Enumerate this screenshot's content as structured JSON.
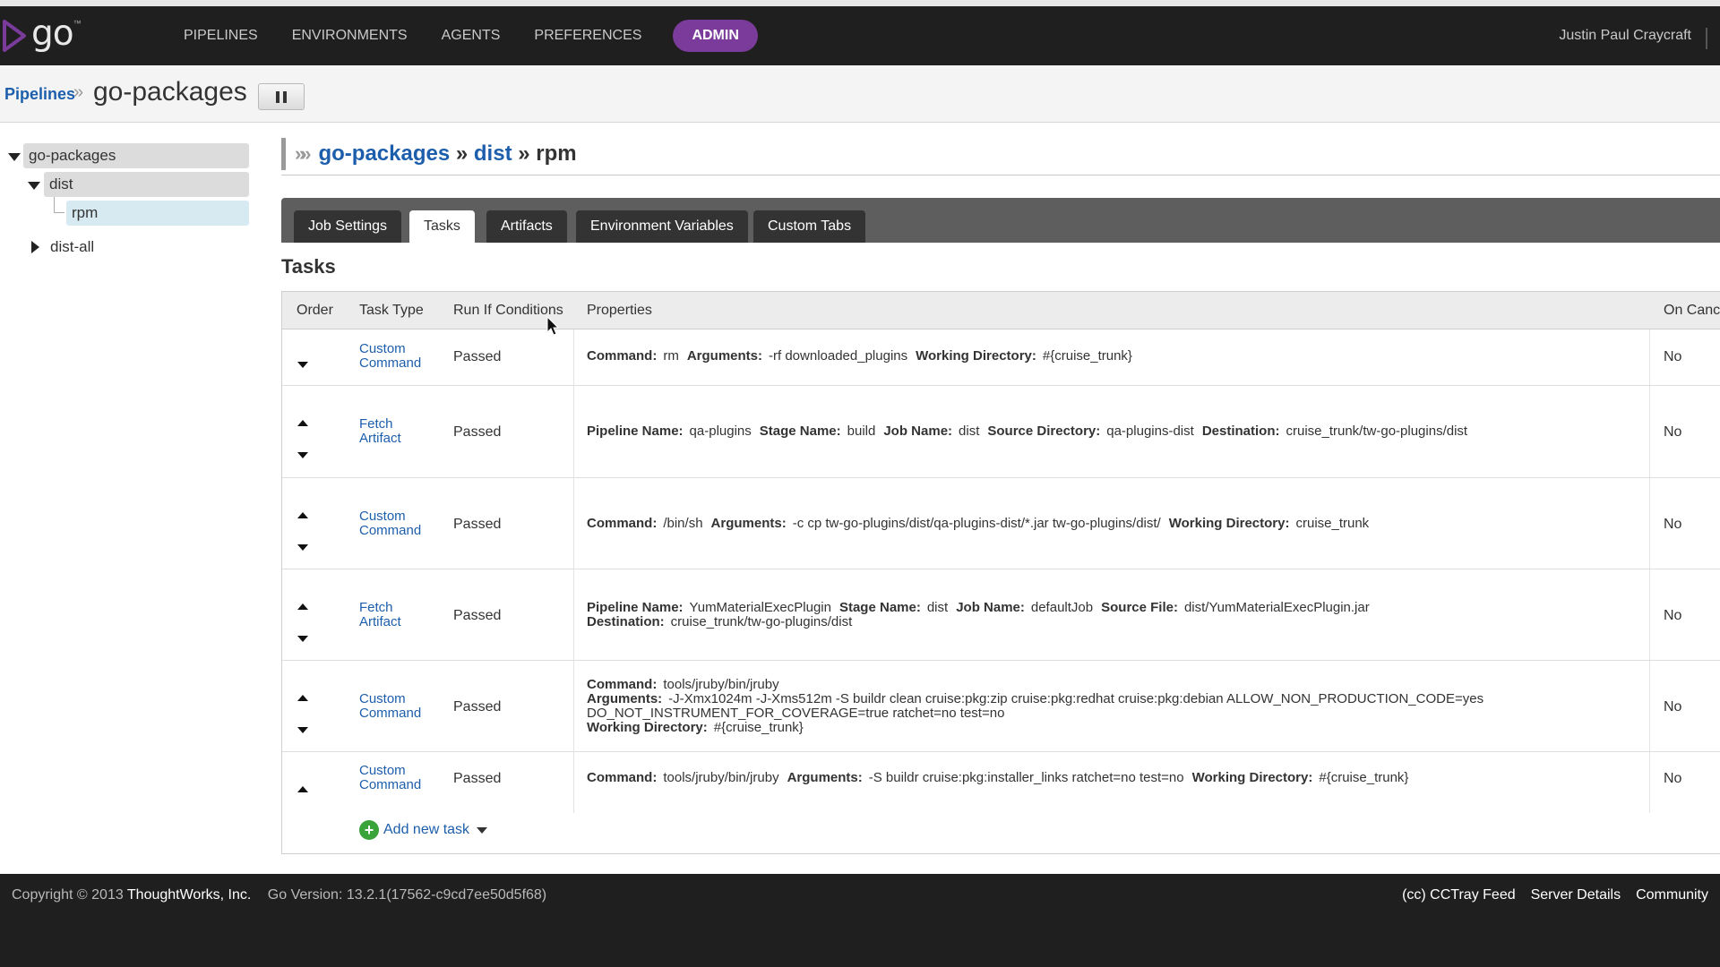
{
  "header": {
    "logo_text": "go",
    "nav": [
      "PIPELINES",
      "ENVIRONMENTS",
      "AGENTS",
      "PREFERENCES",
      "ADMIN"
    ],
    "active_nav": "ADMIN",
    "user": "Justin Paul Craycraft"
  },
  "subheader": {
    "breadcrumb_link": "Pipelines",
    "breadcrumb_sep": "»",
    "pipeline_title": "go-packages"
  },
  "tree": {
    "pipeline": "go-packages",
    "stage": "dist",
    "job": "rpm",
    "other_stage": "dist-all"
  },
  "title": {
    "pipeline": "go-packages",
    "sep1": " » ",
    "stage": "dist",
    "sep2": " » ",
    "job": "rpm"
  },
  "tabs": [
    "Job Settings",
    "Tasks",
    "Artifacts",
    "Environment Variables",
    "Custom Tabs"
  ],
  "active_tab": "Tasks",
  "section_title": "Tasks",
  "table": {
    "headers": {
      "order": "Order",
      "task_type": "Task Type",
      "run_if": "Run If Conditions",
      "properties": "Properties",
      "on_cancel": "On Canc"
    },
    "rows": [
      {
        "type_line1": "Custom",
        "type_line2": "Command",
        "run_if": "Passed",
        "on_cancel": "No",
        "props": [
          [
            "Command:",
            "rm"
          ],
          [
            "Arguments:",
            "-rf downloaded_plugins"
          ],
          [
            "Working Directory:",
            "#{cruise_trunk}"
          ]
        ]
      },
      {
        "type_line1": "Fetch",
        "type_line2": "Artifact",
        "run_if": "Passed",
        "on_cancel": "No",
        "props": [
          [
            "Pipeline Name:",
            "qa-plugins"
          ],
          [
            "Stage Name:",
            "build"
          ],
          [
            "Job Name:",
            "dist"
          ],
          [
            "Source Directory:",
            "qa-plugins-dist"
          ],
          [
            "Destination:",
            "cruise_trunk/tw-go-plugins/dist"
          ]
        ]
      },
      {
        "type_line1": "Custom",
        "type_line2": "Command",
        "run_if": "Passed",
        "on_cancel": "No",
        "props": [
          [
            "Command:",
            "/bin/sh"
          ],
          [
            "Arguments:",
            "-c cp tw-go-plugins/dist/qa-plugins-dist/*.jar tw-go-plugins/dist/"
          ],
          [
            "Working Directory:",
            "cruise_trunk"
          ]
        ]
      },
      {
        "type_line1": "Fetch",
        "type_line2": "Artifact",
        "run_if": "Passed",
        "on_cancel": "No",
        "props": [
          [
            "Pipeline Name:",
            "YumMaterialExecPlugin"
          ],
          [
            "Stage Name:",
            "dist"
          ],
          [
            "Job Name:",
            "defaultJob"
          ],
          [
            "Source File:",
            "dist/YumMaterialExecPlugin.jar"
          ]
        ],
        "props_line2": [
          [
            "Destination:",
            "cruise_trunk/tw-go-plugins/dist"
          ]
        ]
      },
      {
        "type_line1": "Custom",
        "type_line2": "Command",
        "run_if": "Passed",
        "on_cancel": "No",
        "command_label": "Command:",
        "command_value": "tools/jruby/bin/jruby",
        "arguments_label": "Arguments:",
        "arguments_value": "-J-Xmx1024m -J-Xms512m -S buildr clean cruise:pkg:zip cruise:pkg:redhat cruise:pkg:debian ALLOW_NON_PRODUCTION_CODE=yes",
        "arguments_cont": "DO_NOT_INSTRUMENT_FOR_COVERAGE=true ratchet=no test=no",
        "workdir_label": "Working Directory:",
        "workdir_value": "#{cruise_trunk}"
      },
      {
        "type_line1": "Custom",
        "type_line2": "Command",
        "run_if": "Passed",
        "on_cancel": "No",
        "props": [
          [
            "Command:",
            "tools/jruby/bin/jruby"
          ],
          [
            "Arguments:",
            "-S buildr cruise:pkg:installer_links ratchet=no test=no"
          ],
          [
            "Working Directory:",
            "#{cruise_trunk}"
          ]
        ]
      }
    ],
    "add_task_label": "Add new task"
  },
  "footer": {
    "copyright": "Copyright © 2013",
    "company": "ThoughtWorks, Inc.",
    "version": "Go Version: 13.2.1(17562-c9cd7ee50d5f68)",
    "links": [
      "(cc) CCTray Feed",
      "Server Details",
      "Community"
    ]
  },
  "colors": {
    "accent": "#7b3b9b",
    "link": "#1d5eac",
    "selected_job": "#d7eaf1"
  }
}
